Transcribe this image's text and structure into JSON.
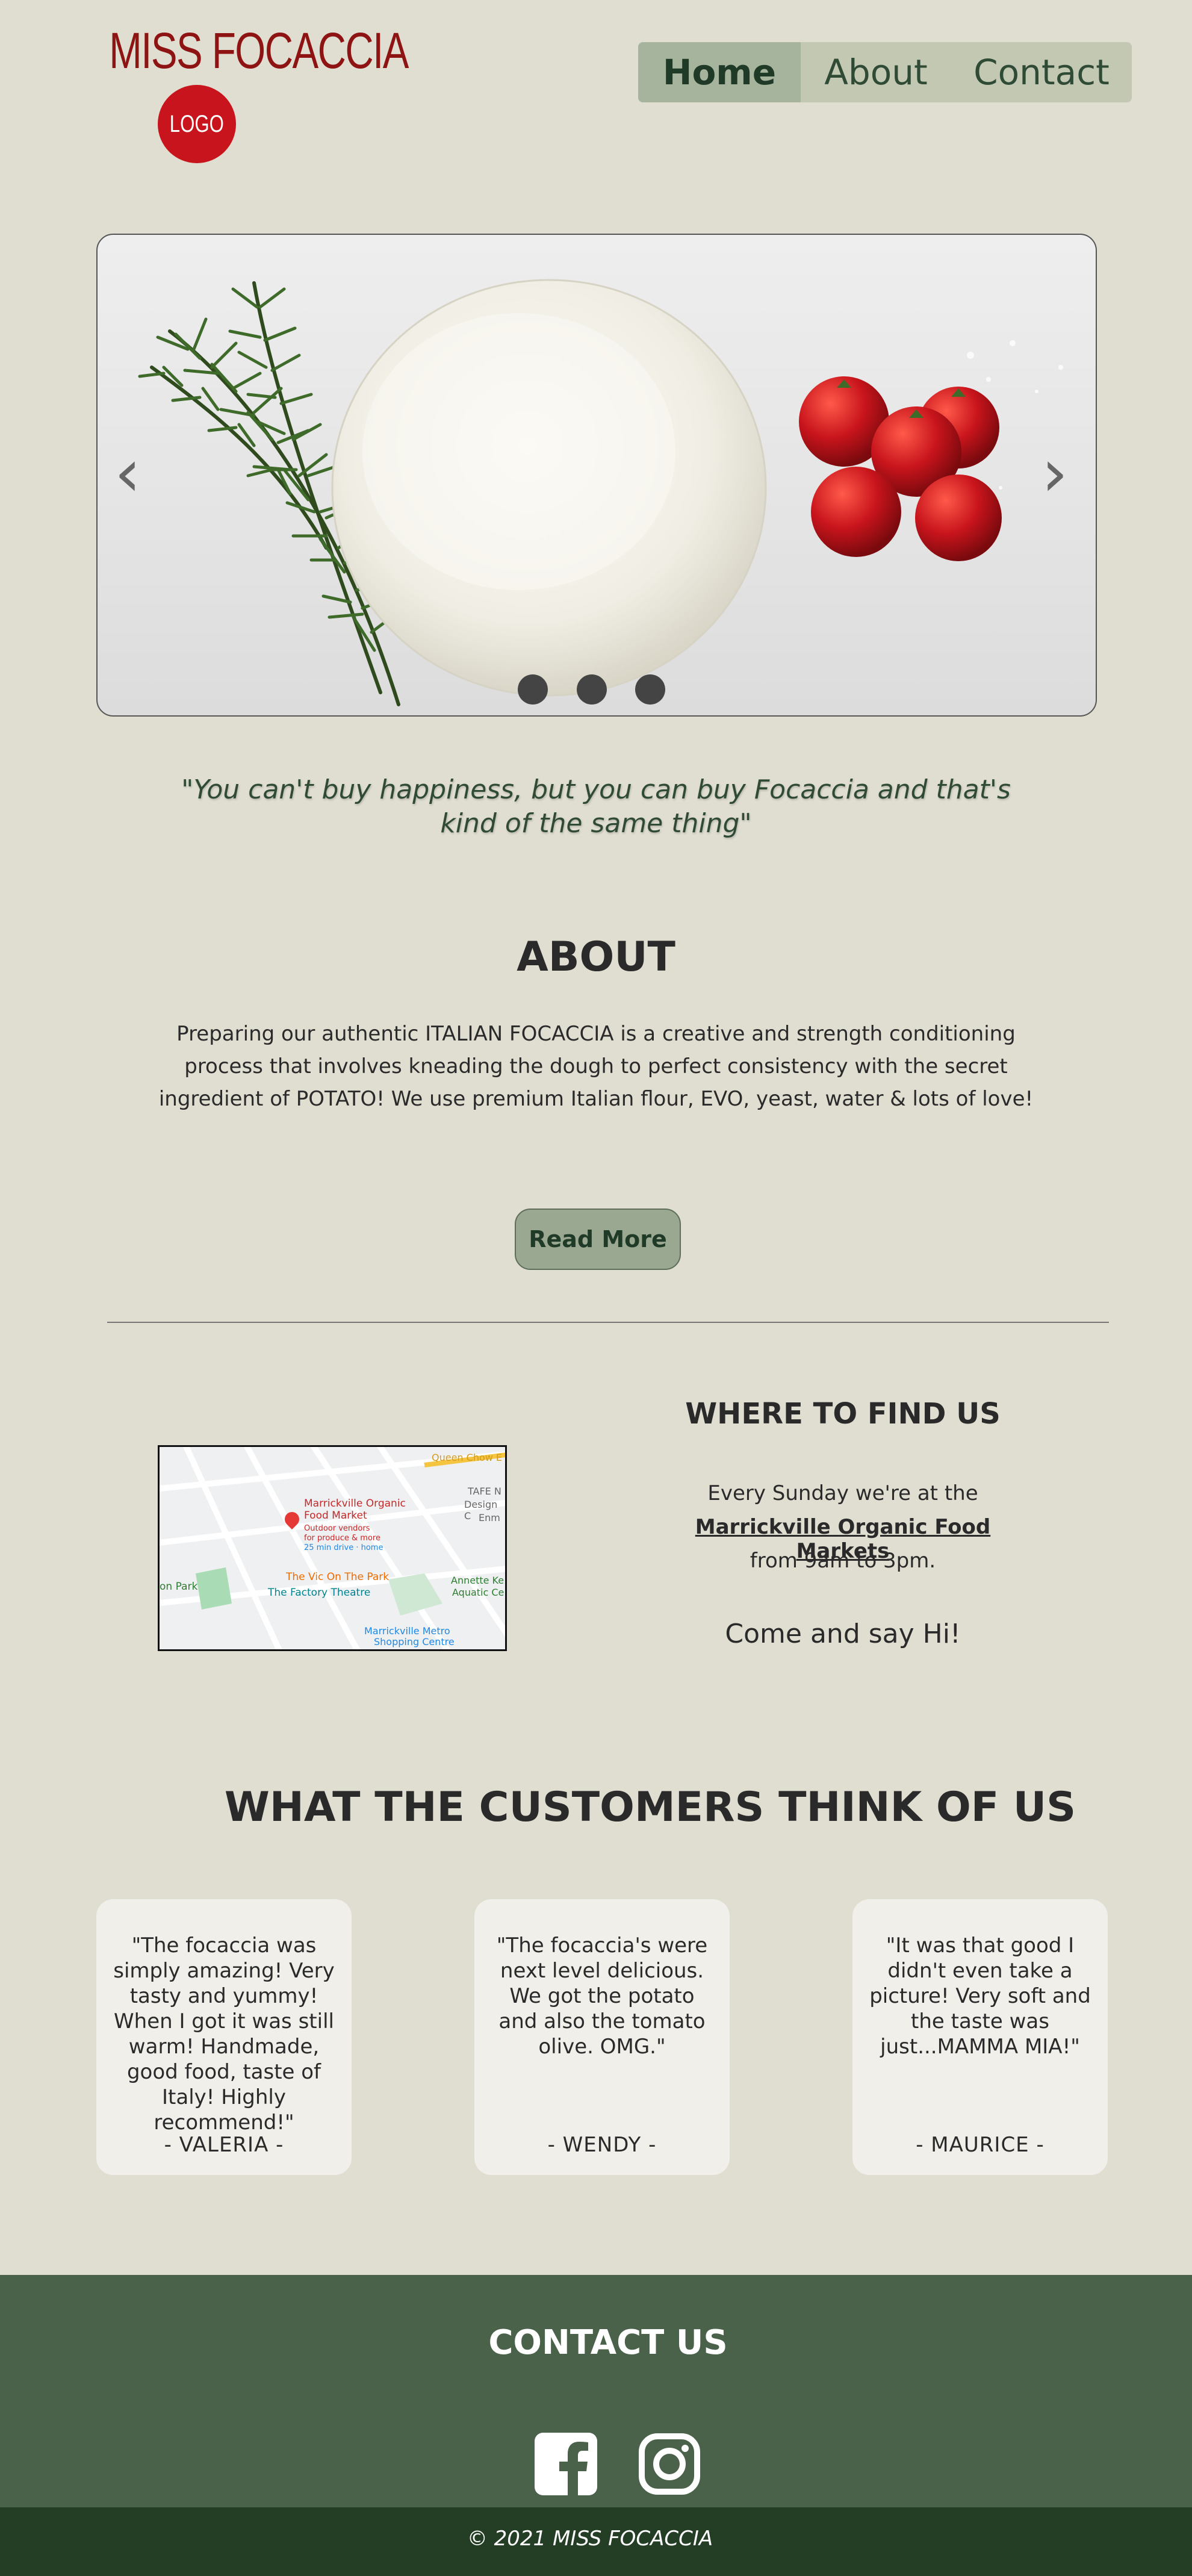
{
  "header": {
    "brand": "MISS FOCACCIA",
    "logo_text": "LOGO",
    "nav": [
      {
        "label": "Home",
        "active": true
      },
      {
        "label": "About",
        "active": false
      },
      {
        "label": "Contact",
        "active": false
      }
    ]
  },
  "carousel": {
    "prev_icon": "chevron-left-icon",
    "next_icon": "chevron-right-icon",
    "slide_count": 3
  },
  "quote": "\"You can't buy happiness, but you can buy Focaccia and that's kind of the same thing\"",
  "about": {
    "title": "ABOUT",
    "text": "Preparing our authentic ITALIAN FOCACCIA is a creative and strength conditioning process that involves kneading the dough to perfect consistency with the secret ingredient of POTATO! We use premium Italian flour, EVO, yeast, water & lots of love!",
    "button": "Read More"
  },
  "find_us": {
    "title": "WHERE TO FIND US",
    "line1": "Every Sunday we're at the",
    "link": "Marrickville Organic Food Markets",
    "line3": "from 9am to 3pm.",
    "say_hi": "Come and say Hi!",
    "map": {
      "street_labels": [
        "Queen Chow E",
        "TAFE N",
        "Design C",
        "Enm"
      ],
      "pin_title": "Marrickville Organic Food Market",
      "pin_sub1": "Outdoor vendors",
      "pin_sub2": "for produce & more",
      "pin_sub3": "25 min drive · home",
      "place1": "The Vic On The Park",
      "place2": "The Factory Theatre",
      "place3": "Annette Ke",
      "place3b": "Aquatic Ce",
      "place4": "on Park",
      "place5": "Marrickville Metro",
      "place5b": "Shopping Centre"
    }
  },
  "customers": {
    "title": "WHAT THE CUSTOMERS THINK OF US",
    "reviews": [
      {
        "text": "\"The focaccia was simply amazing! Very tasty and yummy! When I got it was still warm! Handmade, good food, taste of Italy! Highly recommend!\"",
        "author": "- VALERIA -"
      },
      {
        "text": "\"The focaccia's were next level delicious. We got the potato and also the tomato olive. OMG.\"",
        "author": "- WENDY -"
      },
      {
        "text": "\"It was that good I didn't even take a picture! Very soft and the taste was just...MAMMA MIA!\"",
        "author": "- MAURICE -"
      }
    ]
  },
  "footer": {
    "title": "CONTACT US",
    "icons": [
      "facebook-icon",
      "instagram-icon"
    ],
    "copyright": "© 2021 MISS FOCACCIA"
  },
  "colors": {
    "background": "#e0ddd1",
    "brand_red": "#8e1414",
    "nav_bg": "#c3c8b3",
    "nav_active": "#a6b39d",
    "footer_green": "#4a614a",
    "footer_dark": "#233e24"
  }
}
